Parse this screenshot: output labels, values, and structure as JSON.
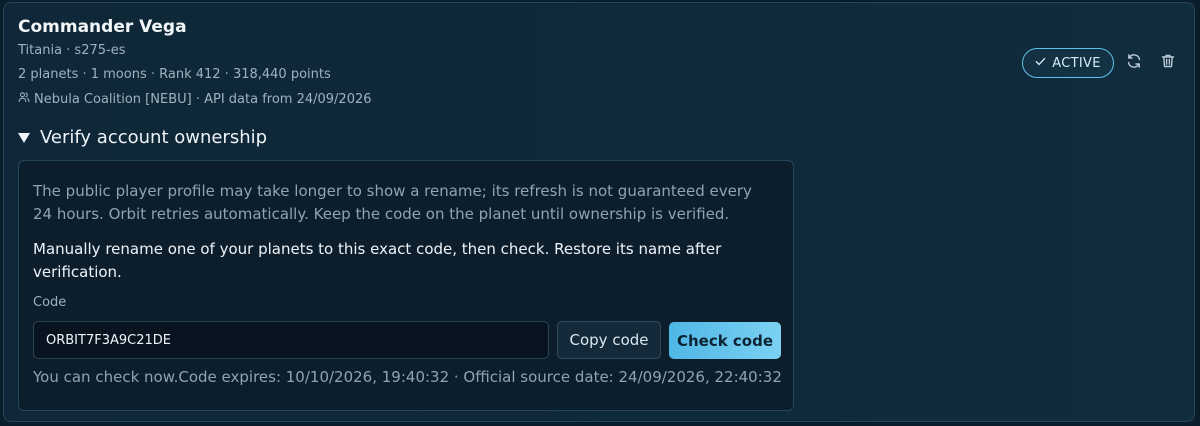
{
  "player": {
    "name": "Commander Vega",
    "server_line": "Titania · s275-es",
    "stats_line": "2 planets · 1 moons · Rank 412 · 318,440 points",
    "alliance_line": "Nebula Coalition [NEBU] · API data from 24/09/2026"
  },
  "status": {
    "label": "ACTIVE",
    "color": "#5fc1e6"
  },
  "actions": {
    "refresh_icon": "refresh-icon",
    "delete_icon": "trash-icon"
  },
  "verify": {
    "heading": "Verify account ownership",
    "notice": "The public player profile may take longer to show a rename; its refresh is not guaranteed every 24 hours. Orbit retries automatically. Keep the code on the planet until ownership is verified.",
    "instruction": "Manually rename one of your planets to this exact code, then check. Restore its name after verification.",
    "code_label": "Code",
    "code_value": "ORBIT7F3A9C21DE",
    "copy_label": "Copy code",
    "check_label": "Check code",
    "status_text": "You can check now.Code expires: 10/10/2026, 19:40:32 · Official source date: 24/09/2026, 22:40:32"
  },
  "colors": {
    "accent": "#5fc1e6",
    "check_button": "#5bbde9",
    "background": "#0f2738"
  }
}
